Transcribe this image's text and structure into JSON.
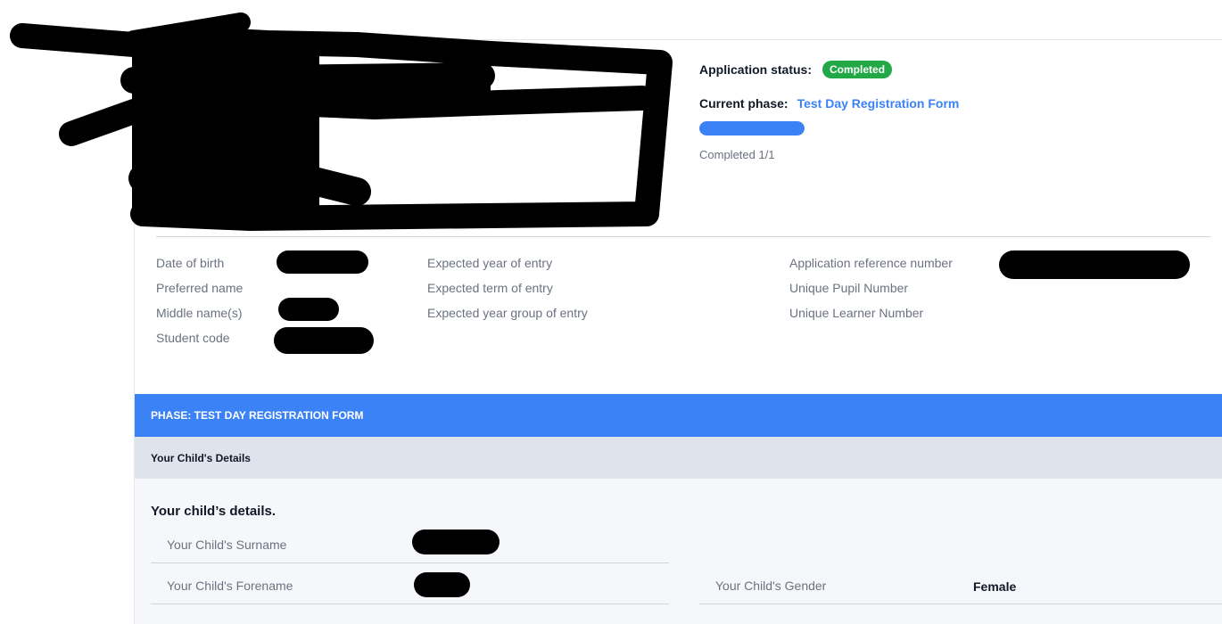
{
  "application": {
    "status_label": "Application status:",
    "status_value": "Completed",
    "status_color": "#22a846",
    "phase_label": "Current phase:",
    "phase_value": "Test Day Registration Form",
    "progress_fraction": 1.0,
    "progress_text": "Completed 1/1"
  },
  "student_info": {
    "col1": [
      "Date of birth",
      "Preferred name",
      "Middle name(s)",
      "Student code"
    ],
    "col2": [
      "Expected year of entry",
      "Expected term of entry",
      "Expected year group of entry"
    ],
    "col3": [
      "Application reference number",
      "Unique Pupil Number",
      "Unique Learner Number"
    ]
  },
  "phase": {
    "header": "PHASE: TEST DAY REGISTRATION FORM",
    "section_title": "Your Child's Details",
    "subsection_title": "Your child’s details.",
    "fields": {
      "surname_label": "Your Child's Surname",
      "forename_label": "Your Child's Forename",
      "gender_label": "Your Child's Gender",
      "gender_value": "Female"
    }
  },
  "colors": {
    "accent": "#3b82f6",
    "section_bg": "#dfe3ec",
    "body_bg": "#f6f7fb"
  }
}
